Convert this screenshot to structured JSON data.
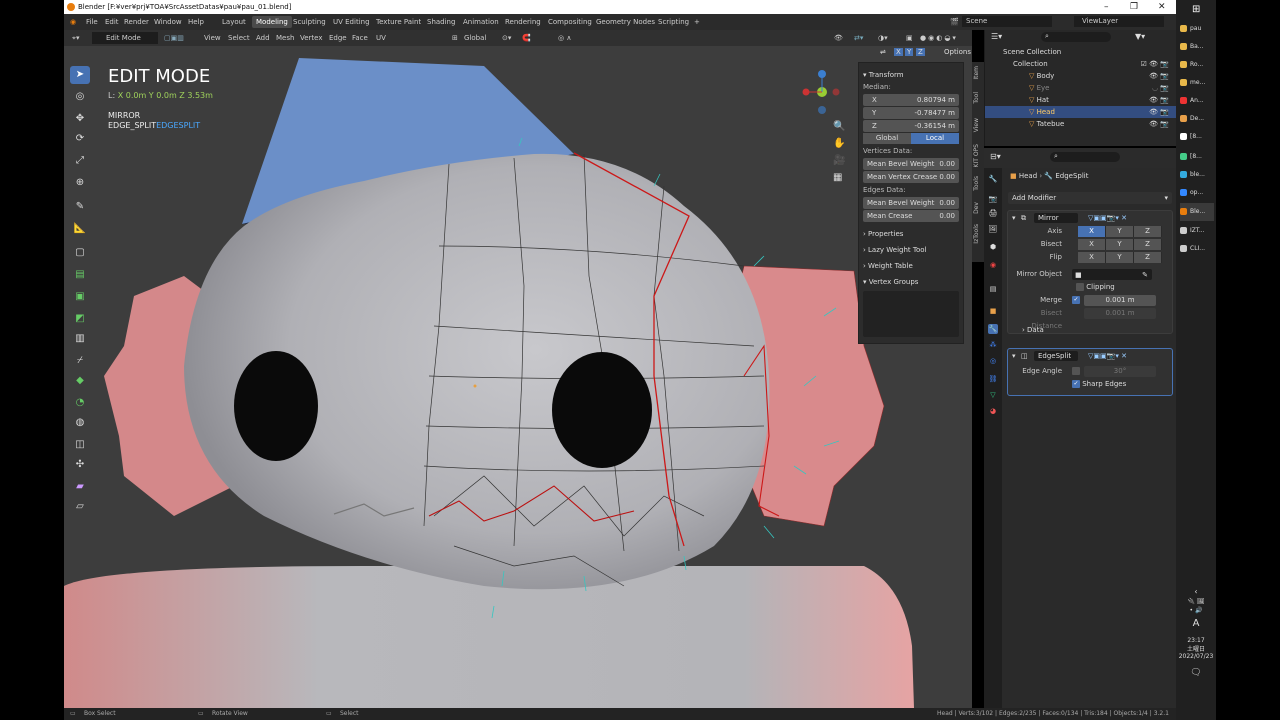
{
  "window": {
    "title": "Blender [F:¥ver¥prj¥TOA¥SrcAssetDatas¥pau¥pau_01.blend]",
    "controls": [
      "–",
      "❐",
      "✕"
    ]
  },
  "menu": [
    "File",
    "Edit",
    "Render",
    "Window",
    "Help"
  ],
  "workspaces": [
    "Layout",
    "Modeling",
    "Sculpting",
    "UV Editing",
    "Texture Paint",
    "Shading",
    "Animation",
    "Rendering",
    "Compositing",
    "Geometry Nodes",
    "Scripting",
    "+"
  ],
  "active_workspace": "Modeling",
  "scene": {
    "scene_name": "Scene",
    "view_layer": "ViewLayer"
  },
  "viewport_header": {
    "mode": "Edit Mode",
    "menus": [
      "View",
      "Select",
      "Add",
      "Mesh",
      "Vertex",
      "Edge",
      "Face",
      "UV"
    ],
    "orientation": "Global",
    "options": "Options",
    "axes": [
      "X",
      "Y",
      "Z"
    ]
  },
  "overlay": {
    "mode_title": "EDIT MODE",
    "coords": {
      "l": "L:",
      "x": "X 0.0m",
      "y": "Y 0.0m",
      "z": "Z 3.53m"
    },
    "mod1": "MIRROR",
    "mod2a": "EDGE_SPLIT",
    "mod2b": "EDGESPLIT"
  },
  "npanel": {
    "transform": "Transform",
    "median": "Median:",
    "x": {
      "label": "X",
      "value": "0.80794 m"
    },
    "y": {
      "label": "Y",
      "value": "-0.78477 m"
    },
    "z": {
      "label": "Z",
      "value": "-0.36154 m"
    },
    "global": "Global",
    "local": "Local",
    "vertices_data": "Vertices Data:",
    "mean_bevel_weight": "Mean Bevel Weight",
    "mean_vertex_crease": "Mean Vertex Crease",
    "edges_data": "Edges Data:",
    "mean_crease": "Mean Crease",
    "zero": "0.00",
    "properties": "Properties",
    "lazy_weight": "Lazy Weight Tool",
    "weight_table": "Weight Table",
    "vertex_groups": "Vertex Groups",
    "tabs": [
      "Item",
      "Tool",
      "View",
      "KIT OPS",
      "Tools",
      "Dev",
      "IzTools"
    ]
  },
  "outliner": {
    "root": "Scene Collection",
    "collection": "Collection",
    "items": [
      "Body",
      "Eye",
      "Hat",
      "Head",
      "Tatebue"
    ],
    "selected": "Head"
  },
  "properties": {
    "breadcrumb_obj": "Head",
    "breadcrumb_mod": "EdgeSplit",
    "add_modifier": "Add Modifier",
    "mirror": {
      "name": "Mirror",
      "axis": "Axis",
      "bisect": "Bisect",
      "flip": "Flip",
      "mirror_object": "Mirror Object",
      "clipping": "Clipping",
      "merge": "Merge",
      "merge_value": "0.001 m",
      "bisect_distance": "Bisect Distance",
      "bisect_value": "0.001 m",
      "data": "Data"
    },
    "edgesplit": {
      "name": "EdgeSplit",
      "edge_angle": "Edge Angle",
      "edge_angle_value": "30°",
      "sharp_edges": "Sharp Edges"
    }
  },
  "statusbar": {
    "left1": "Box Select",
    "left2": "Rotate View",
    "left3": "Select",
    "stats": "Head | Verts:3/102 | Edges:2/235 | Faces:0/134 | Tris:184 | Objects:1/4 | 3.2.1"
  },
  "taskbar": {
    "items": [
      "pau",
      "Ba...",
      "Ro...",
      "me...",
      "An...",
      "De...",
      "[8...",
      "[8...",
      "ble...",
      "op...",
      "Ble...",
      "IZT...",
      "CLI..."
    ],
    "time": "23:17",
    "day": "土曜日",
    "date": "2022/07/23",
    "ime": "A"
  }
}
